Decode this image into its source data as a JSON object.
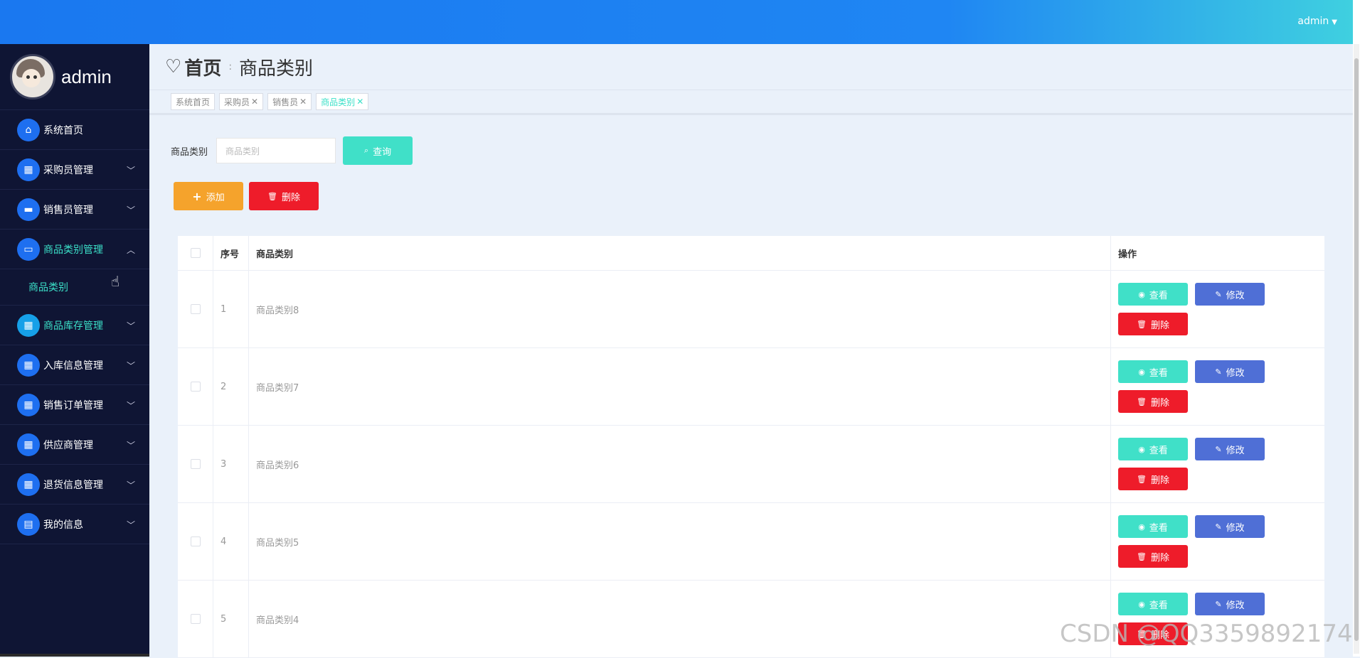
{
  "header": {
    "username": "admin"
  },
  "sidebar": {
    "brand_name": "admin",
    "items": [
      {
        "label": "系统首页",
        "icon": "home-icon"
      },
      {
        "label": "采购员管理",
        "icon": "grid-icon"
      },
      {
        "label": "销售员管理",
        "icon": "chat-icon"
      },
      {
        "label": "商品类别管理",
        "icon": "monitor-icon"
      },
      {
        "label": "商品库存管理",
        "icon": "grid-icon"
      },
      {
        "label": "入库信息管理",
        "icon": "grid-icon"
      },
      {
        "label": "销售订单管理",
        "icon": "grid-icon"
      },
      {
        "label": "供应商管理",
        "icon": "grid-icon"
      },
      {
        "label": "退货信息管理",
        "icon": "grid-icon"
      },
      {
        "label": "我的信息",
        "icon": "wallet-icon"
      }
    ],
    "subitem": "商品类别"
  },
  "page": {
    "home": "首页",
    "separator": ":",
    "title": "商品类别"
  },
  "tabs": [
    {
      "label": "系统首页",
      "closable": false
    },
    {
      "label": "采购员",
      "closable": true
    },
    {
      "label": "销售员",
      "closable": true
    },
    {
      "label": "商品类别",
      "closable": true
    }
  ],
  "search": {
    "label": "商品类别",
    "placeholder": "商品类别",
    "button": "查询"
  },
  "actions": {
    "add": "添加",
    "delete": "删除"
  },
  "table": {
    "columns": [
      "序号",
      "商品类别",
      "操作"
    ],
    "rows": [
      {
        "index": "1",
        "name": "商品类别8"
      },
      {
        "index": "2",
        "name": "商品类别7"
      },
      {
        "index": "3",
        "name": "商品类别6"
      },
      {
        "index": "4",
        "name": "商品类别5"
      },
      {
        "index": "5",
        "name": "商品类别4"
      }
    ],
    "row_actions": {
      "view": "查看",
      "edit": "修改",
      "delete": "删除"
    }
  },
  "watermark": "CSDN @QQ3359892174",
  "colors": {
    "accent": "#40e0c8",
    "primary": "#1e6ff0",
    "danger": "#ee1c2a",
    "warning": "#f5a32c",
    "sidebar": "#0f1534"
  }
}
